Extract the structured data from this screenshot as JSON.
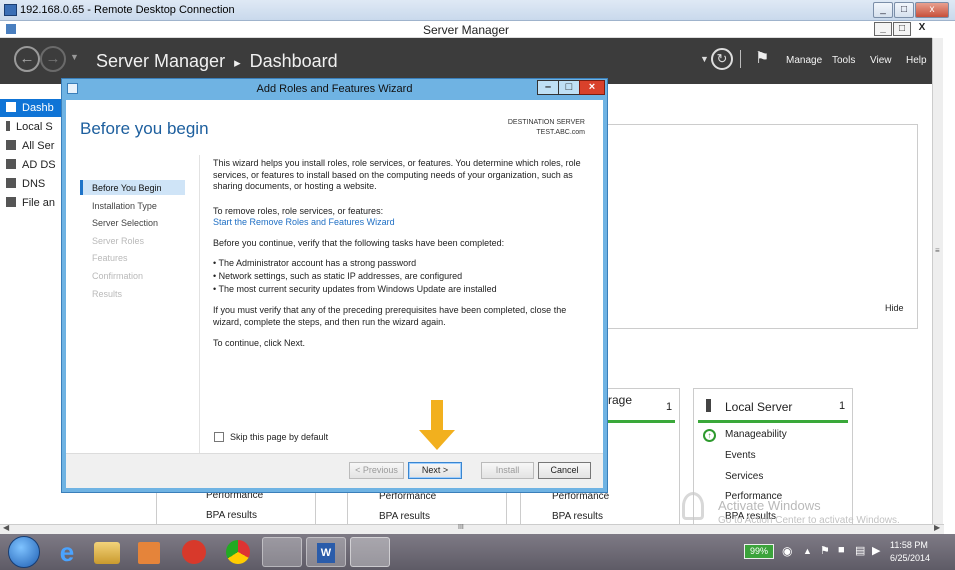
{
  "rdp": {
    "title": "192.168.0.65 - Remote Desktop Connection",
    "min": "_",
    "restore": "□",
    "close": "x"
  },
  "sm": {
    "title": "Server Manager",
    "min": "_",
    "restore": "□",
    "close": "X"
  },
  "header": {
    "app": "Server Manager",
    "sep": "▸",
    "page": "Dashboard",
    "menu": [
      "Manage",
      "Tools",
      "View",
      "Help"
    ]
  },
  "sidebar": {
    "items": [
      "Dashb",
      "Local S",
      "All Ser",
      "AD DS",
      "DNS",
      "File an"
    ]
  },
  "welcome": {
    "hide": "Hide"
  },
  "tiles": {
    "storage": {
      "title": "rage",
      "count": "1"
    },
    "local": {
      "title": "Local Server",
      "count": "1",
      "items": [
        "Manageability",
        "Events",
        "Services",
        "Performance",
        "BPA results"
      ]
    },
    "rows": [
      "Performance",
      "BPA results"
    ]
  },
  "activate": {
    "line1": "Activate Windows",
    "line2": "Go to Action Center to activate Windows."
  },
  "wizard": {
    "title": "Add Roles and Features Wizard",
    "heading": "Before you begin",
    "dest_label": "DESTINATION SERVER",
    "dest_server": "TEST.ABC.com",
    "nav": [
      {
        "label": "Before You Begin",
        "state": "selected"
      },
      {
        "label": "Installation Type",
        "state": "enabled"
      },
      {
        "label": "Server Selection",
        "state": "enabled"
      },
      {
        "label": "Server Roles",
        "state": "disabled"
      },
      {
        "label": "Features",
        "state": "disabled"
      },
      {
        "label": "Confirmation",
        "state": "disabled"
      },
      {
        "label": "Results",
        "state": "disabled"
      }
    ],
    "p1": "This wizard helps you install roles, role services, or features. You determine which roles, role services, or features to install based on the computing needs of your organization, such as sharing documents, or hosting a website.",
    "p2": "To remove roles, role services, or features:",
    "link": "Start the Remove Roles and Features Wizard",
    "p3": "Before you continue, verify that the following tasks have been completed:",
    "bullets": [
      "The Administrator account has a strong password",
      "Network settings, such as static IP addresses, are configured",
      "The most current security updates from Windows Update are installed"
    ],
    "p4": "If you must verify that any of the preceding prerequisites have been completed, close the wizard, complete the steps, and then run the wizard again.",
    "p5": "To continue, click Next.",
    "skip": "Skip this page by default",
    "buttons": {
      "prev": "< Previous",
      "next": "Next >",
      "install": "Install",
      "cancel": "Cancel"
    }
  },
  "taskbar": {
    "battery": "99%",
    "time": "11:58 PM",
    "date": "6/25/2014"
  },
  "hscroll_label": "III"
}
